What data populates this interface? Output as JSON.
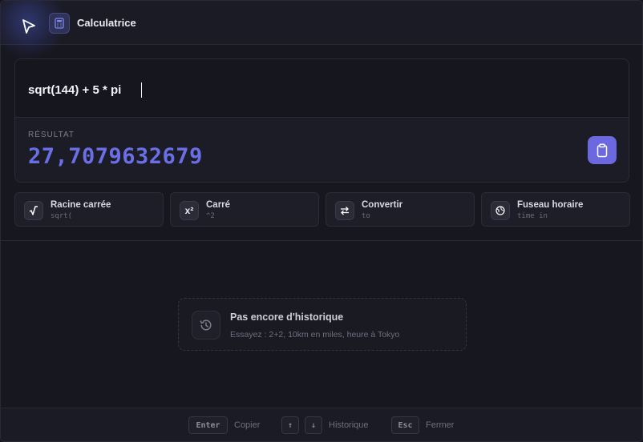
{
  "header": {
    "title": "Calculatrice",
    "cursor_icon": "cursor-arrow-icon",
    "app_icon": "calculator-icon",
    "accent": "#6c69e0"
  },
  "calculator": {
    "expression": "sqrt(144) + 5 * pi",
    "result_label": "RÉSULTAT",
    "result_value": "27,7079632679",
    "copy_icon": "clipboard-icon"
  },
  "chips": [
    {
      "icon": "square-root-icon",
      "glyph": "√",
      "title": "Racine carrée",
      "sub": "sqrt("
    },
    {
      "icon": "square-icon",
      "glyph": "x²",
      "title": "Carré",
      "sub": "^2"
    },
    {
      "icon": "convert-icon",
      "glyph": "⇄",
      "title": "Convertir",
      "sub": "to"
    },
    {
      "icon": "globe-icon",
      "glyph": "",
      "title": "Fuseau horaire",
      "sub": "time in"
    }
  ],
  "history": {
    "empty_title": "Pas encore d'historique",
    "empty_hint": "Essayez : 2+2, 10km en miles, heure à Tokyo",
    "icon": "history-icon"
  },
  "footer": {
    "enter_key": "Enter",
    "enter_label": "Copier",
    "up_key": "↑",
    "down_key": "↓",
    "nav_label": "Historique",
    "esc_key": "Esc",
    "esc_label": "Fermer"
  }
}
